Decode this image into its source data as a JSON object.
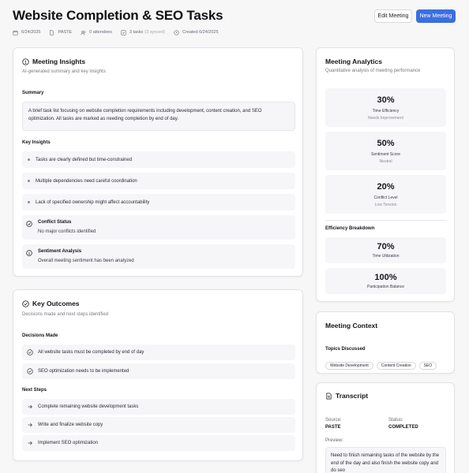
{
  "header": {
    "title": "Website Completion & SEO Tasks",
    "edit_button": "Edit Meeting",
    "new_button": "New Meeting"
  },
  "meta": {
    "date": "6/24/2025",
    "source": "PASTE",
    "attendees": "0 attendees",
    "tasks": "3 tasks",
    "tasks_synced": "(3 synced)",
    "created": "Created 6/24/2025"
  },
  "insights": {
    "title": "Meeting Insights",
    "subtitle": "AI-generated summary and key insights",
    "summary_label": "Summary",
    "summary_text": "A brief task list focusing on website completion requirements including development, content creation, and SEO optimization. All tasks are marked as needing completion by end of day.",
    "key_insights_label": "Key Insights",
    "key_insights": [
      "Tasks are clearly defined but time-constrained",
      "Multiple dependencies need careful coordination",
      "Lack of specified ownership might affect accountability"
    ],
    "conflict_title": "Conflict Status",
    "conflict_text": "No major conflicts identified",
    "sentiment_title": "Sentiment Analysis",
    "sentiment_text": "Overall meeting sentiment has been analyzed"
  },
  "outcomes": {
    "title": "Key Outcomes",
    "subtitle": "Decisions made and next steps identified",
    "decisions_label": "Decisions Made",
    "decisions": [
      "All website tasks must be completed by end of day",
      "SEO optimization needs to be implemented"
    ],
    "next_steps_label": "Next Steps",
    "next_steps": [
      "Complete remaining website development tasks",
      "Write and finalize website copy",
      "Implement SEO optimization"
    ]
  },
  "analytics": {
    "title": "Meeting Analytics",
    "subtitle": "Quantitative analysis of meeting performance",
    "metrics": [
      {
        "value": "30%",
        "label": "Time Efficiency",
        "sub": "Needs Improvement"
      },
      {
        "value": "50%",
        "label": "Sentiment Score",
        "sub": "Neutral"
      },
      {
        "value": "20%",
        "label": "Conflict Level",
        "sub": "Low Tension"
      }
    ],
    "efficiency_label": "Efficiency Breakdown",
    "breakdown": [
      {
        "value": "70%",
        "label": "Time Utilization"
      },
      {
        "value": "100%",
        "label": "Participation Balance"
      }
    ]
  },
  "context": {
    "title": "Meeting Context",
    "topics_label": "Topics Discussed",
    "topics": [
      "Website Development",
      "Content Creation",
      "SEO"
    ]
  },
  "transcript": {
    "title": "Transcript",
    "source_label": "Source:",
    "source_value": "PASTE",
    "status_label": "Status:",
    "status_value": "COMPLETED",
    "preview_label": "Preview:",
    "preview_text": "Need to finish remaining tasks of the website by the end of the day and also finish the website copy and do seo"
  },
  "colors": {
    "accent": "#3b6fe0",
    "page_bg": "#f7f7f8",
    "card_bg": "#ffffff",
    "row_bg": "#f6f6f9"
  },
  "icons": {
    "meta": [
      "calendar-icon",
      "document-icon",
      "users-icon",
      "checkbox-icon",
      "clock-icon"
    ],
    "insights": "lightbulb-icon",
    "outcomes": "check-circle-icon",
    "transcript": "file-text-icon",
    "next_step": "arrow-right-icon"
  }
}
